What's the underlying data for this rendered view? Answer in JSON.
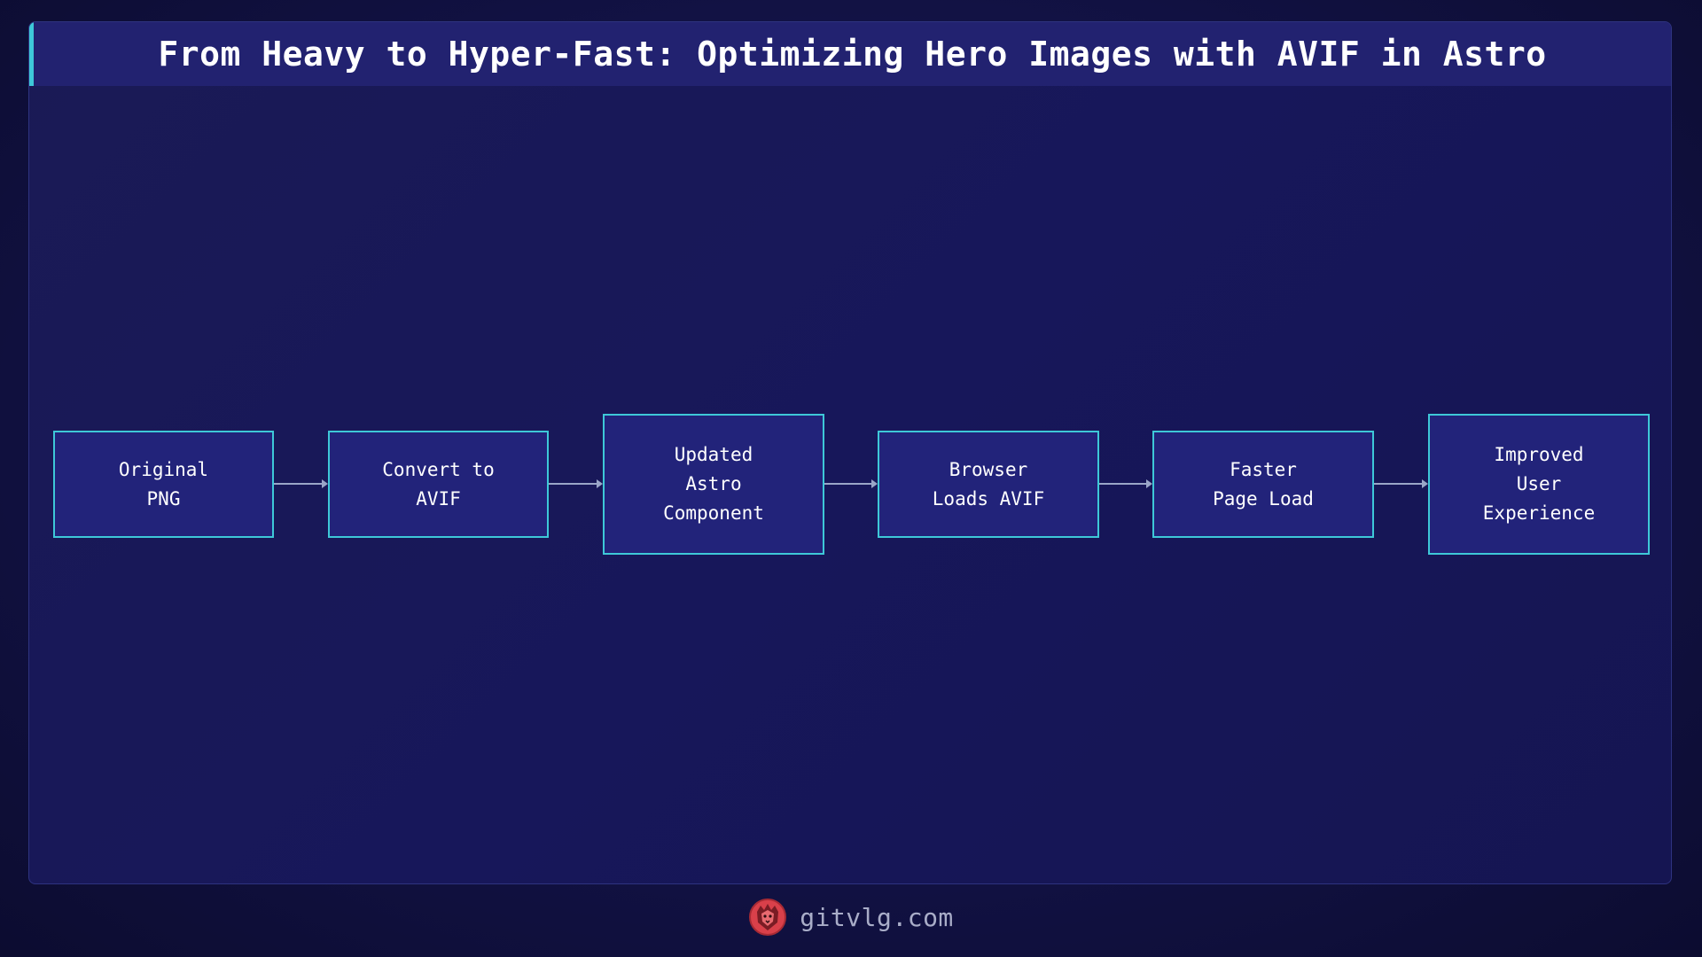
{
  "title": "From Heavy to Hyper-Fast: Optimizing Hero Images with AVIF in Astro",
  "nodes": [
    {
      "label": "Original\nPNG"
    },
    {
      "label": "Convert to\nAVIF"
    },
    {
      "label": "Updated\nAstro\nComponent"
    },
    {
      "label": "Browser\nLoads AVIF"
    },
    {
      "label": "Faster\nPage Load"
    },
    {
      "label": "Improved\nUser\nExperience"
    }
  ],
  "edges": [
    {
      "from": 0,
      "to": 1
    },
    {
      "from": 1,
      "to": 2
    },
    {
      "from": 2,
      "to": 3
    },
    {
      "from": 3,
      "to": 4
    },
    {
      "from": 4,
      "to": 5
    }
  ],
  "footer": {
    "logo_icon": "lion-head-icon",
    "text": "gitvlg.com"
  },
  "colors": {
    "accent": "#3ec8d8",
    "node_fill": "#22237a",
    "title_bar": "#222270",
    "logo": "#d9404a"
  }
}
